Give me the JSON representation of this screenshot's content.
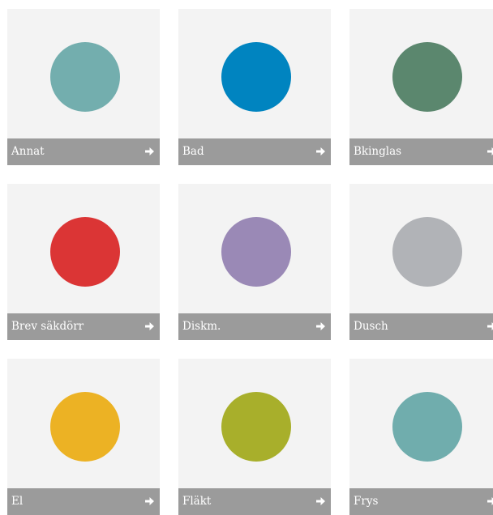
{
  "tiles": [
    {
      "label": "Annat",
      "color": "#73aeae",
      "icon": "arrow-right-icon"
    },
    {
      "label": "Bad",
      "color": "#0084c0",
      "icon": "arrow-right-icon"
    },
    {
      "label": "Bkinglas",
      "color": "#5b876e",
      "icon": "arrow-right-icon"
    },
    {
      "label": "Brev säkdörr",
      "color": "#db3535",
      "icon": "arrow-right-icon"
    },
    {
      "label": "Diskm.",
      "color": "#9a89b6",
      "icon": "arrow-right-icon"
    },
    {
      "label": "Dusch",
      "color": "#b1b3b7",
      "icon": "arrow-right-icon"
    },
    {
      "label": "El",
      "color": "#ecb224",
      "icon": "arrow-right-icon"
    },
    {
      "label": "Fläkt",
      "color": "#a8af2b",
      "icon": "arrow-right-icon"
    },
    {
      "label": "Frys",
      "color": "#70adad",
      "icon": "arrow-right-icon"
    }
  ]
}
